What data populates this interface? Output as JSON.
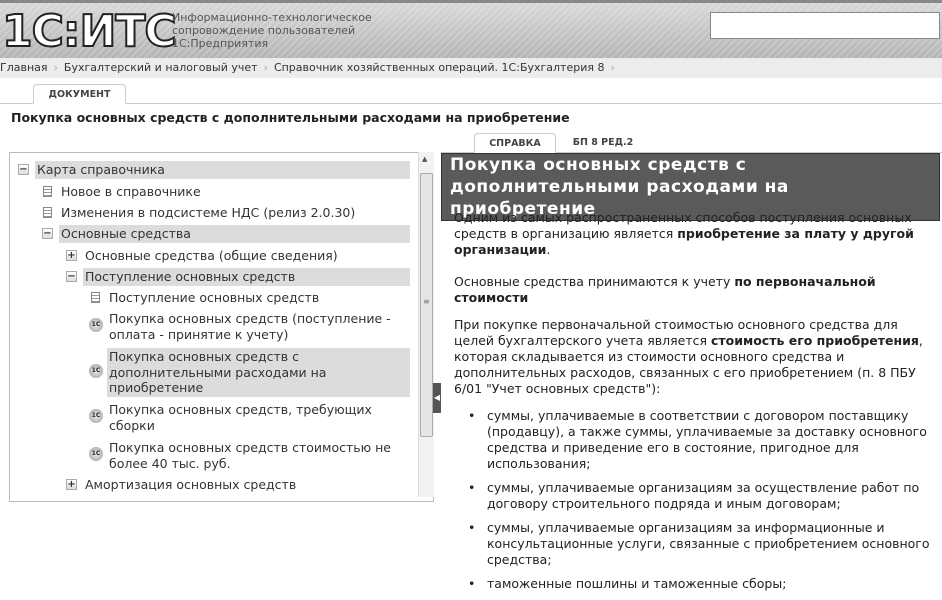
{
  "header": {
    "logo": "1С:ИТС",
    "subtitle": [
      "Информационно-технологическое",
      "сопровождение пользователей",
      "1С:Предприятия"
    ],
    "search_value": ""
  },
  "breadcrumbs": [
    "Главная",
    "Бухгалтерский и налоговый учет",
    "Справочник хозяйственных операций. 1С:Бухгалтерия 8"
  ],
  "tabs": {
    "document": "ДОКУМЕНТ",
    "help": "СПРАВКА",
    "bp": "БП 8 РЕД.2"
  },
  "doc_title": "Покупка основных средств с дополнительными расходами на приобретение",
  "tree": [
    {
      "label": "Карта справочника",
      "icon": "minus",
      "level": 0
    },
    {
      "label": "Новое в справочнике",
      "icon": "doc",
      "level": 1
    },
    {
      "label": "Изменения в подсистеме НДС (релиз 2.0.30)",
      "icon": "doc",
      "level": 1
    },
    {
      "label": "Основные средства",
      "icon": "minus",
      "level": 1
    },
    {
      "label": "Основные средства (общие сведения)",
      "icon": "plus",
      "level": 2
    },
    {
      "label": "Поступление основных средств",
      "icon": "minus",
      "level": 2
    },
    {
      "label": "Поступление основных средств",
      "icon": "doc",
      "level": 3
    },
    {
      "label": "Покупка основных средств (поступление - оплата - принятие к учету)",
      "icon": "1c",
      "level": 3
    },
    {
      "label": "Покупка основных средств с дополнительными расходами на приобретение",
      "icon": "1c",
      "level": 3,
      "selected": true
    },
    {
      "label": "Покупка основных средств, требующих сборки",
      "icon": "1c",
      "level": 3
    },
    {
      "label": "Покупка основных средств стоимостью не более 40 тыс. руб.",
      "icon": "1c",
      "level": 3
    },
    {
      "label": "Амортизация основных средств",
      "icon": "plus",
      "level": 2
    }
  ],
  "article": {
    "heading": "Покупка основных средств с дополнительными расходами на приобретение",
    "p1": "Одним из самых распространенных способов поступления основных средств в организацию является",
    "p1_bold": "приобретение за плату у другой организации",
    "p2": "Основные средства принимаются к учету ",
    "p2_bold": "по первоначальной стоимости",
    "p3a": "При покупке первоначальной стоимостью основного средства для целей бухгалтерского учета",
    "p3b": "является ",
    "p3b_bold": "стоимость его приобретения",
    "p3b_rest": ", которая складывается из стоимости",
    "p3c": "основного средства и дополнительных расходов, связанных с его приобретением (п. 8 ПБУ 6/01",
    "p3d": "\"Учет основных средств\"):",
    "bullets": [
      [
        "суммы, уплачиваемые в соответствии с договором поставщику (продавцу), а также",
        "суммы, уплачиваемые за доставку основного средства и приведение его в состояние,",
        "пригодное для использования;"
      ],
      [
        "суммы, уплачиваемые организациям за осуществление работ по договору строительного",
        "подряда и иным договорам;"
      ],
      [
        "суммы, уплачиваемые организациям за информационные и консультационные услуги,",
        "связанные с приобретением основного средства;"
      ],
      [
        "таможенные пошлины и таможенные сборы;"
      ]
    ]
  }
}
